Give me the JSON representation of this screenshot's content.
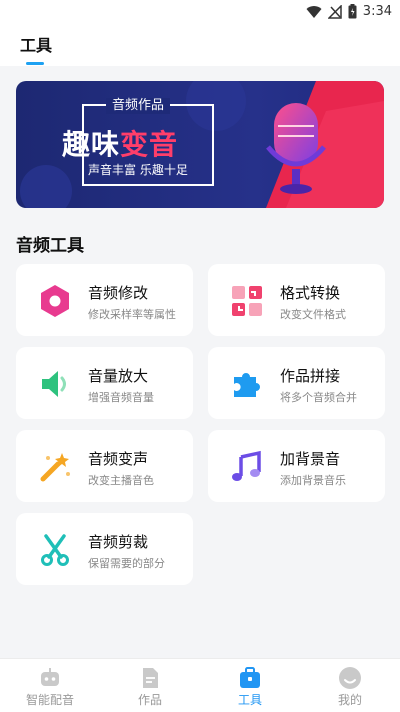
{
  "status_bar": {
    "time": "3:34"
  },
  "header": {
    "tab_label": "工具"
  },
  "banner": {
    "tag": "音频作品",
    "title_main": "趣味",
    "title_highlight": "变音",
    "subtitle": "声音丰富 乐趣十足"
  },
  "section": {
    "title": "音频工具"
  },
  "tools": [
    {
      "title": "音频修改",
      "desc": "修改采样率等属性",
      "icon": "hexagon-icon",
      "color": "#e83a8f"
    },
    {
      "title": "格式转换",
      "desc": "改变文件格式",
      "icon": "convert-icon",
      "color": "#f0426e"
    },
    {
      "title": "音量放大",
      "desc": "增强音频音量",
      "icon": "speaker-icon",
      "color": "#2ec27e"
    },
    {
      "title": "作品拼接",
      "desc": "将多个音频合并",
      "icon": "puzzle-icon",
      "color": "#1e9bf0"
    },
    {
      "title": "音频变声",
      "desc": "改变主播音色",
      "icon": "magic-wand-icon",
      "color": "#f5a623"
    },
    {
      "title": "加背景音",
      "desc": "添加背景音乐",
      "icon": "music-note-icon",
      "color": "#6c4de6"
    },
    {
      "title": "音频剪裁",
      "desc": "保留需要的部分",
      "icon": "scissors-icon",
      "color": "#1fbfb8"
    }
  ],
  "bottom_nav": [
    {
      "label": "智能配音",
      "icon": "robot-icon"
    },
    {
      "label": "作品",
      "icon": "document-icon"
    },
    {
      "label": "工具",
      "icon": "toolbox-icon",
      "active": true
    },
    {
      "label": "我的",
      "icon": "profile-icon"
    }
  ]
}
